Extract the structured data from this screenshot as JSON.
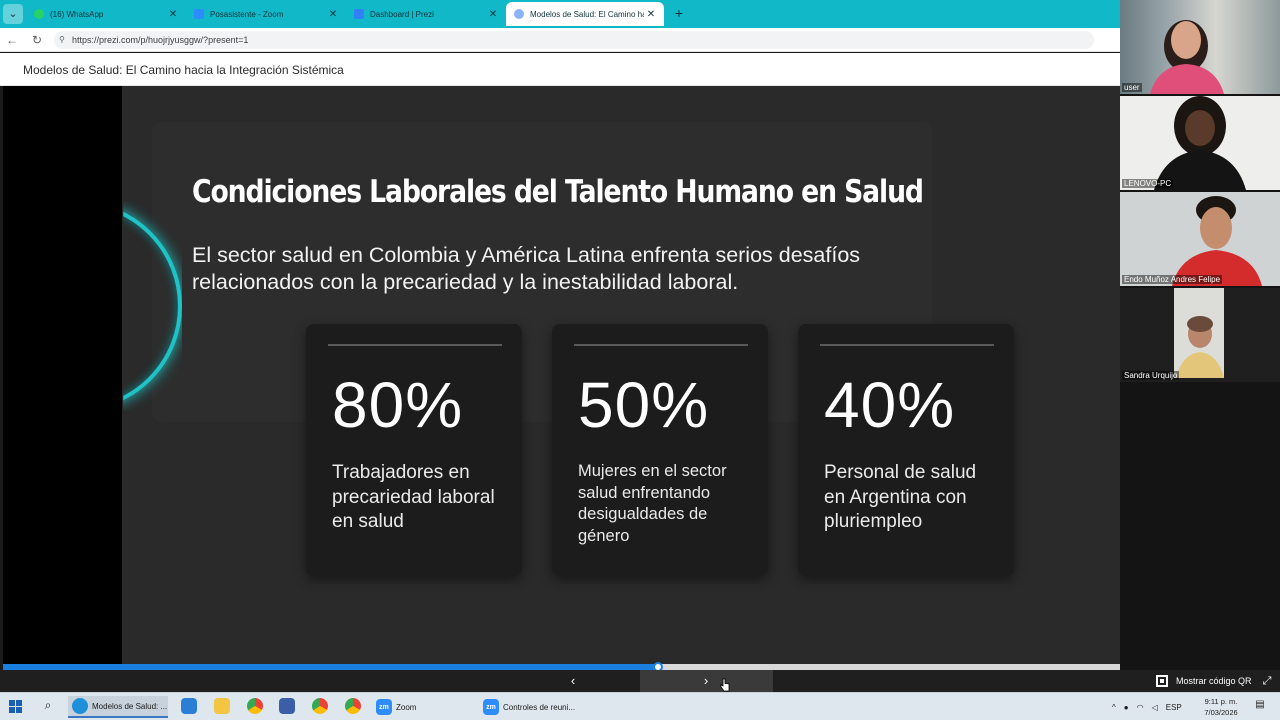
{
  "browser": {
    "tabs": [
      {
        "label": "(16) WhatsApp",
        "icon": "whatsapp-icon",
        "color": "#25d366"
      },
      {
        "label": "Posasistente - Zoom",
        "icon": "zoom-icon",
        "color": "#2d8cff"
      },
      {
        "label": "Dashboard | Prezi",
        "icon": "prezi-icon",
        "color": "#3181ff"
      },
      {
        "label": "Modelos de Salud: El Camino hacia",
        "icon": "prezi-icon",
        "color": "#3181ff"
      }
    ],
    "url": "https://prezi.com/p/huojrjyusggw/?present=1"
  },
  "prezi": {
    "title": "Modelos de Salud: El Camino hacia la Integración Sistémica"
  },
  "slide": {
    "heading": "Condiciones Laborales del Talento Humano en Salud",
    "subtitle": "El sector salud en Colombia y América Latina enfrenta serios desafíos relacionados con la precariedad y la inestabilidad laboral.",
    "cards": [
      {
        "value": "80%",
        "text": "Trabajadores en precariedad laboral en salud"
      },
      {
        "value": "50%",
        "text": "Mujeres en el sector salud enfrentando desigualdades de género"
      },
      {
        "value": "40%",
        "text": "Personal de salud en Argentina con pluriempleo"
      }
    ],
    "accent_color": "#1fd3d6"
  },
  "controls": {
    "progress": 0.568,
    "prev_icon": "chevron-left-icon",
    "next_icon": "chevron-right-icon",
    "qr_label": "Mostrar código QR"
  },
  "zoom": {
    "participants": [
      {
        "name": "user"
      },
      {
        "name": "LENOVO-PC"
      },
      {
        "name": "Endo Muñoz Andres Felipe"
      },
      {
        "name": "Sandra Urquijo"
      }
    ]
  },
  "taskbar": {
    "apps": [
      {
        "label": "Modelos de Salud: ...",
        "icon": "edge-icon"
      },
      {
        "label": "Zoom",
        "icon": "zoom-icon"
      },
      {
        "label": "Controles de reuni...",
        "icon": "zoom-icon"
      }
    ],
    "language": "ESP",
    "time": "9:11 p. m.",
    "date": "7/03/2026"
  }
}
